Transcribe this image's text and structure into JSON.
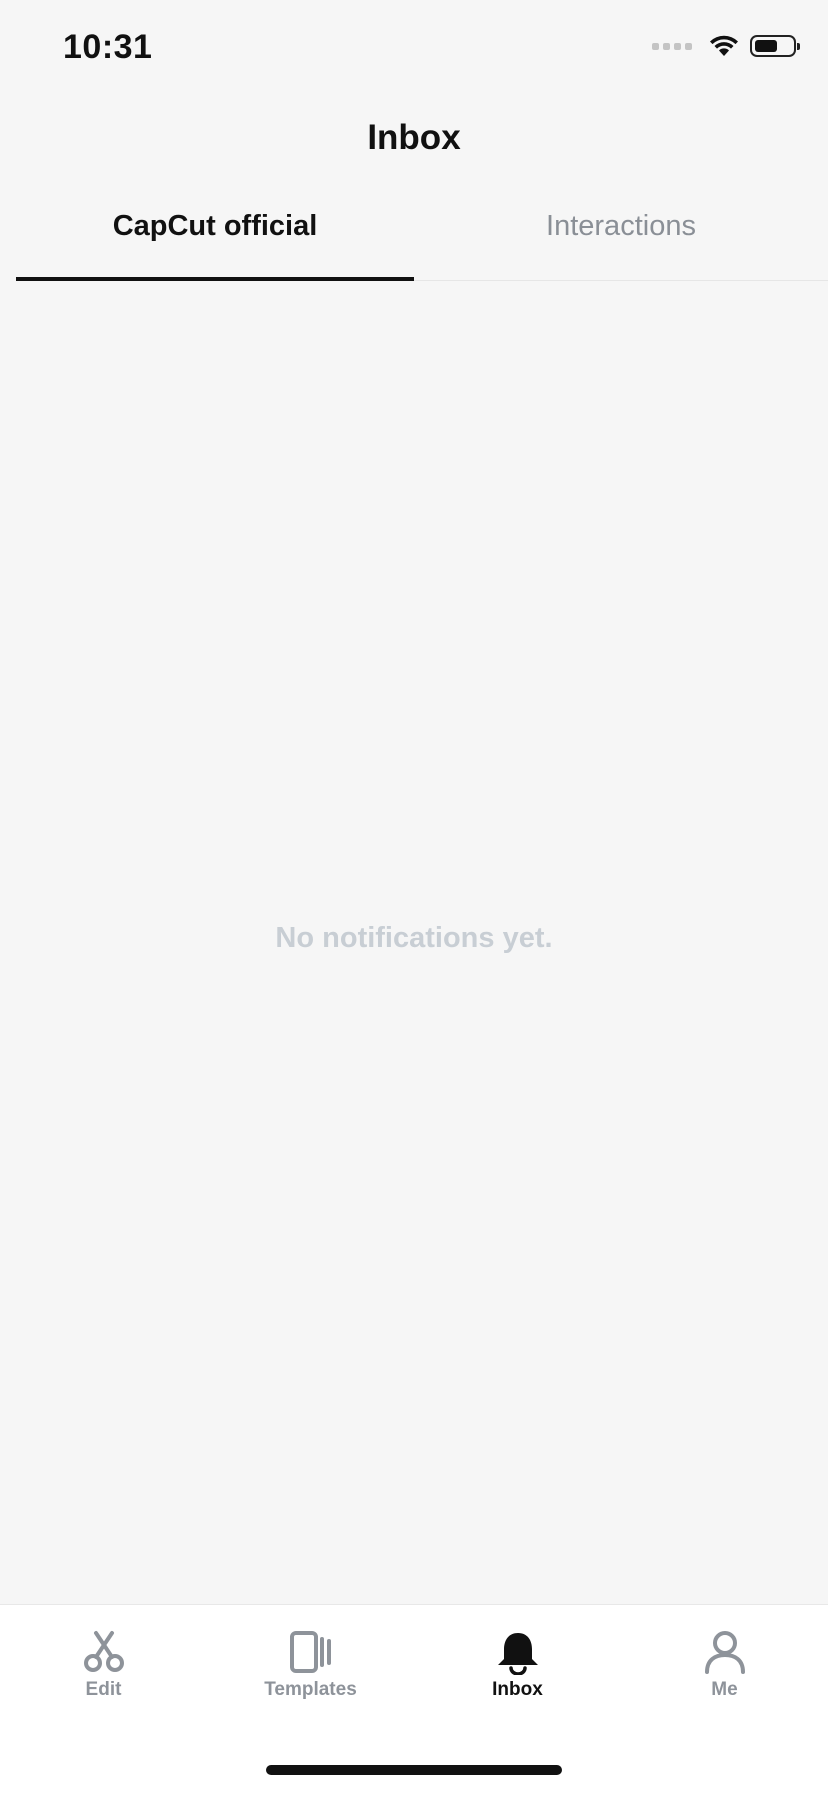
{
  "status_bar": {
    "time": "10:31",
    "icons": [
      "signal-icon",
      "wifi-icon",
      "battery-icon"
    ]
  },
  "header": {
    "title": "Inbox"
  },
  "tabs": [
    {
      "label": "CapCut official",
      "active": true
    },
    {
      "label": "Interactions",
      "active": false
    }
  ],
  "content": {
    "empty_message": "No notifications yet."
  },
  "bottom_nav": {
    "items": [
      {
        "label": "Edit",
        "icon": "scissors-icon",
        "active": false
      },
      {
        "label": "Templates",
        "icon": "templates-icon",
        "active": false
      },
      {
        "label": "Inbox",
        "icon": "bell-icon",
        "active": true
      },
      {
        "label": "Me",
        "icon": "person-icon",
        "active": false
      }
    ]
  },
  "colors": {
    "background": "#f6f6f6",
    "text_primary": "#111111",
    "text_inactive": "#8a8f96",
    "empty_text": "#c8ced4",
    "nav_background": "#ffffff"
  }
}
